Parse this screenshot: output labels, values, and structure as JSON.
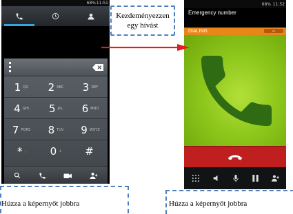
{
  "left_phone": {
    "status_time": "11:51",
    "status_battery": "68%",
    "keys": [
      {
        "digit": "1",
        "letters": "QO"
      },
      {
        "digit": "2",
        "letters": "ABC"
      },
      {
        "digit": "3",
        "letters": "DEF"
      },
      {
        "digit": "4",
        "letters": "GHI"
      },
      {
        "digit": "5",
        "letters": "JKL"
      },
      {
        "digit": "6",
        "letters": "MNO"
      },
      {
        "digit": "7",
        "letters": "PQRS"
      },
      {
        "digit": "8",
        "letters": "TUV"
      },
      {
        "digit": "9",
        "letters": "WXYZ"
      },
      {
        "digit": "*",
        "letters": ","
      },
      {
        "digit": "0",
        "letters": "+"
      },
      {
        "digit": "#",
        "letters": ""
      }
    ],
    "tab_icons": [
      "phone-icon",
      "clock-icon",
      "contact-icon"
    ],
    "bottom_icons": [
      "search-icon",
      "call-icon",
      "video-call-icon",
      "add-contact-icon"
    ]
  },
  "right_phone": {
    "status_time": "11:52",
    "status_battery": "68%",
    "emergency_label": "Emergency number",
    "dialing_label": "DIALING",
    "dial_badge": "•••",
    "control_icons": [
      "keypad-icon",
      "speaker-icon",
      "mute-icon",
      "hold-icon",
      "add-call-icon"
    ]
  },
  "callout": {
    "text": "Kezdeményezzen egy hívást"
  },
  "captions": {
    "left": "Húzza a képernyőt jobbra",
    "right": "Húzza a képernyőt jobbra"
  },
  "colors": {
    "accent_blue": "#34a6e0",
    "dialing_orange": "#e8861a",
    "end_call_red": "#bf1f1f",
    "call_green": "#8fc81c",
    "arrow_red": "#e02020",
    "dash_blue": "#4f7fbf"
  }
}
